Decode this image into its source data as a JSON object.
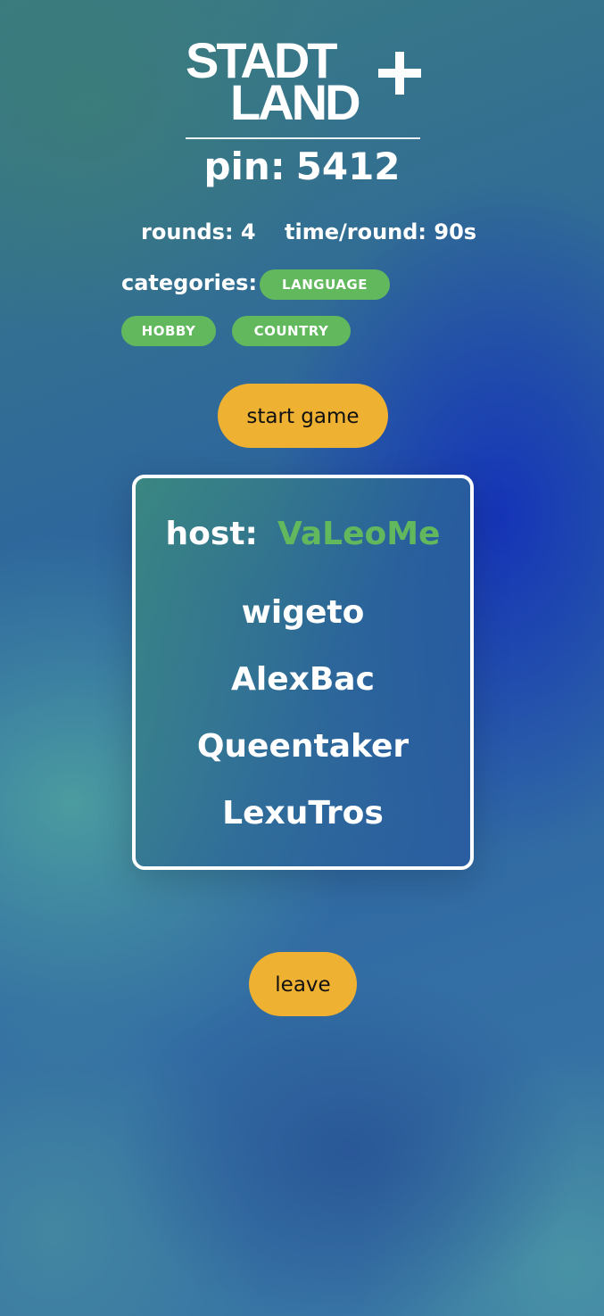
{
  "logo": {
    "line1": "STADT",
    "line2": "LAND",
    "plus_icon": "plus-icon"
  },
  "pin": {
    "label": "pin:",
    "value": "5412"
  },
  "settings": {
    "rounds": "rounds: 4",
    "time_per_round": "time/round: 90s"
  },
  "categories": {
    "label": "categories:",
    "items": [
      "LANGUAGE",
      "HOBBY",
      "COUNTRY"
    ],
    "chip_color": "#62b85d"
  },
  "actions": {
    "start_label": "start game",
    "leave_label": "leave",
    "button_color": "#efb132"
  },
  "players": {
    "host_label": "host:",
    "host_name": "VaLeoMe",
    "host_color": "#62b85d",
    "list": [
      "wigeto",
      "AlexBac",
      "Queentaker",
      "LexuTros"
    ]
  }
}
